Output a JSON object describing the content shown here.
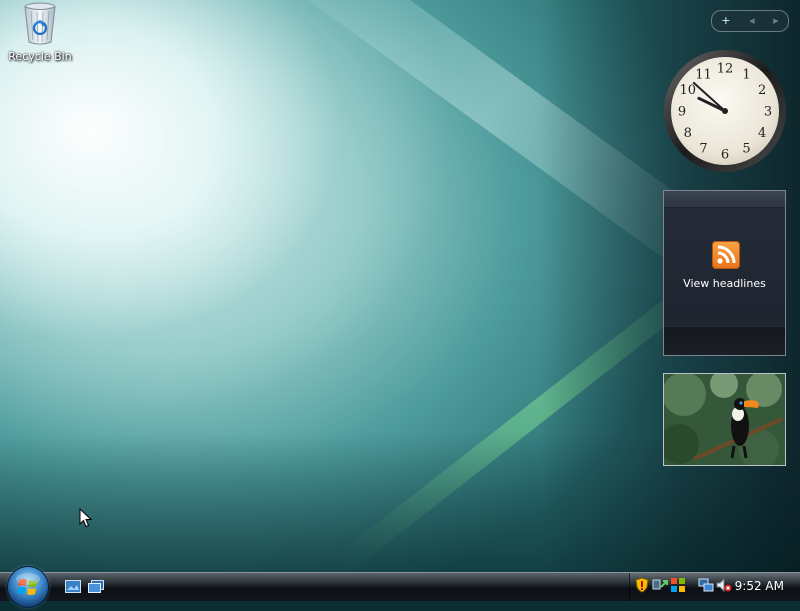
{
  "desktop": {
    "icons": [
      {
        "label": "Recycle Bin",
        "icon": "recycle-bin-icon"
      }
    ]
  },
  "sidebar": {
    "controls": {
      "add_symbol": "+",
      "prev_symbol": "◂",
      "next_symbol": "▸"
    },
    "clock": {
      "numerals": [
        "12",
        "1",
        "2",
        "3",
        "4",
        "5",
        "6",
        "7",
        "8",
        "9",
        "10",
        "11"
      ],
      "time_shown": "9:52"
    },
    "feed_headlines": {
      "label": "View headlines",
      "icon": "rss-icon"
    },
    "slideshow": {
      "icon": "toucan-photo"
    }
  },
  "taskbar": {
    "start": {
      "icon": "windows-start-orb-icon"
    },
    "quick_launch": [
      {
        "icon": "show-desktop-icon"
      },
      {
        "icon": "switch-windows-icon"
      }
    ],
    "tray": {
      "icons": [
        "security-shield-icon",
        "network-activity-icon",
        "windows-update-icon",
        "network-icon",
        "volume-muted-icon"
      ],
      "clock": "9:52 AM"
    }
  },
  "colors": {
    "rss_orange": "#e8731a",
    "taskbar": "#12171c",
    "wallpaper_teal": "#2f7c80"
  }
}
